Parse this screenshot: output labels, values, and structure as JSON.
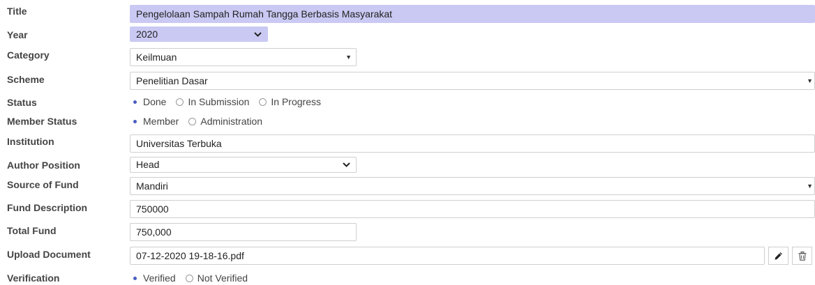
{
  "labels": {
    "title": "Title",
    "year": "Year",
    "category": "Category",
    "scheme": "Scheme",
    "status": "Status",
    "member_status": "Member Status",
    "institution": "Institution",
    "author_position": "Author Position",
    "source_of_fund": "Source of Fund",
    "fund_description": "Fund Description",
    "total_fund": "Total Fund",
    "upload_document": "Upload Document",
    "verification": "Verification"
  },
  "values": {
    "title": "Pengelolaan Sampah Rumah Tangga Berbasis Masyarakat",
    "year": "2020",
    "category": "Keilmuan",
    "scheme": "Penelitian Dasar",
    "institution": "Universitas Terbuka",
    "author_position": "Head",
    "source_of_fund": "Mandiri",
    "fund_description": "750000",
    "total_fund": "750,000",
    "upload_document": "07-12-2020 19-18-16.pdf"
  },
  "status": {
    "options": [
      "Done",
      "In Submission",
      "In Progress"
    ],
    "selected": "Done"
  },
  "member_status": {
    "options": [
      "Member",
      "Administration"
    ],
    "selected": "Member"
  },
  "verification": {
    "options": [
      "Verified",
      "Not Verified"
    ],
    "selected": "Verified"
  },
  "icons": {
    "edit": "pencil-icon",
    "delete": "trash-icon",
    "select_caret": "caret-down-icon",
    "select_chevron": "chevron-down-icon"
  },
  "colors": {
    "highlight": "#c9c9f3",
    "radio_accent": "#4a5dc4"
  }
}
